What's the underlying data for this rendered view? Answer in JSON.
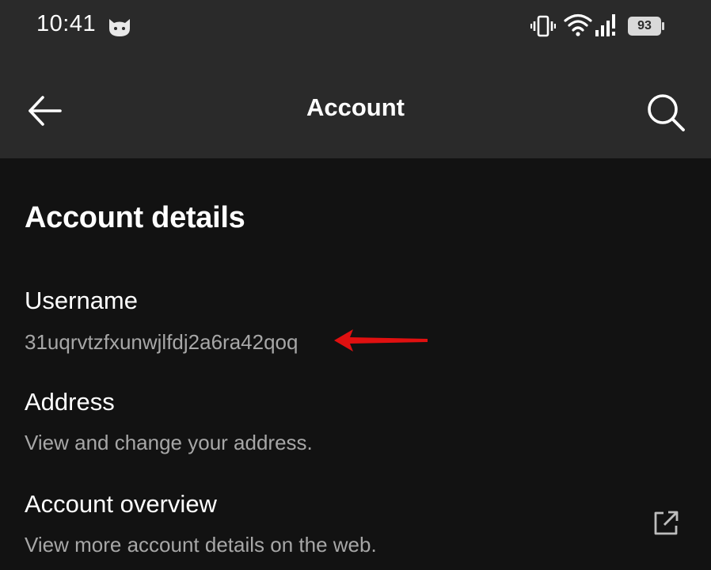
{
  "status_bar": {
    "time": "10:41",
    "battery": "93",
    "icons": [
      "cat-icon",
      "vibrate-icon",
      "wifi-icon",
      "signal-icon",
      "battery-icon"
    ]
  },
  "app_bar": {
    "title": "Account",
    "back_icon": "arrow-left-icon",
    "search_icon": "search-icon"
  },
  "section": {
    "heading": "Account details"
  },
  "items": [
    {
      "label": "Username",
      "sub": "31uqrvtzfxunwjlfdj2a6ra42qoq"
    },
    {
      "label": "Address",
      "sub": "View and change your address."
    },
    {
      "label": "Account overview",
      "sub": "View more account details on the web.",
      "trailing_icon": "external-link-icon"
    }
  ],
  "colors": {
    "background": "#121212",
    "bar": "#2a2a2a",
    "text_primary": "#ffffff",
    "text_secondary": "#a7a7a7",
    "annotation": "#e01010"
  }
}
